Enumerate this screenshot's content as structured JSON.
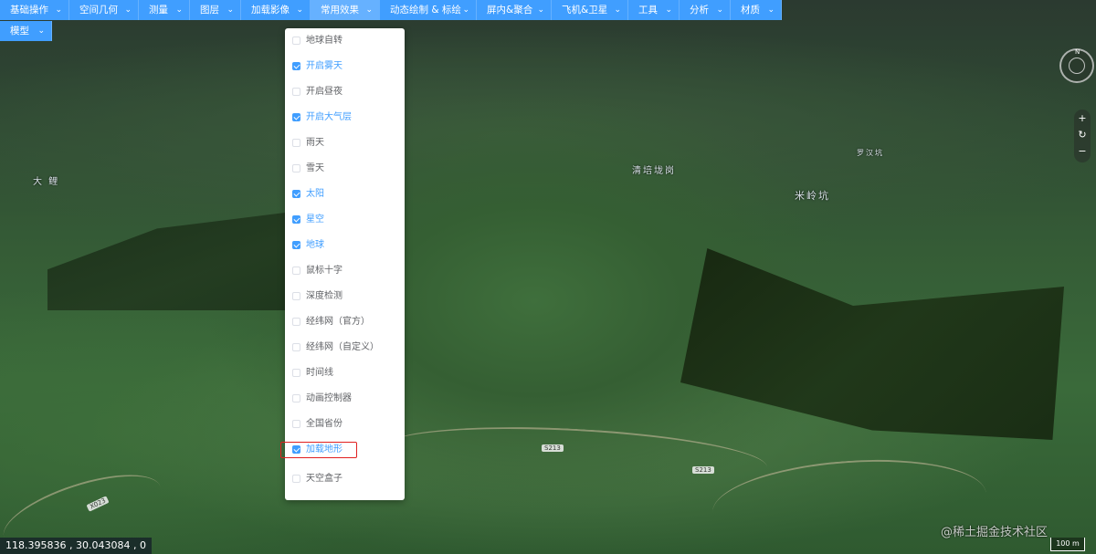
{
  "menu": {
    "items": [
      {
        "label": "基础操作"
      },
      {
        "label": "空间几何"
      },
      {
        "label": "测量"
      },
      {
        "label": "图层"
      },
      {
        "label": "加载影像"
      },
      {
        "label": "常用效果"
      },
      {
        "label": "动态绘制 & 标绘"
      },
      {
        "label": "屏内&聚合"
      },
      {
        "label": "飞机&卫星"
      },
      {
        "label": "工具"
      },
      {
        "label": "分析"
      },
      {
        "label": "材质"
      }
    ],
    "second_row": [
      {
        "label": "模型"
      }
    ],
    "active": "常用效果"
  },
  "dropdown": {
    "items": [
      {
        "label": "地球自转",
        "checked": false
      },
      {
        "label": "开启雾天",
        "checked": true
      },
      {
        "label": "开启昼夜",
        "checked": false
      },
      {
        "label": "开启大气层",
        "checked": true
      },
      {
        "label": "雨天",
        "checked": false
      },
      {
        "label": "雪天",
        "checked": false
      },
      {
        "label": "太阳",
        "checked": true
      },
      {
        "label": "星空",
        "checked": true
      },
      {
        "label": "地球",
        "checked": true
      },
      {
        "label": "鼠标十字",
        "checked": false
      },
      {
        "label": "深度检测",
        "checked": false
      },
      {
        "label": "经纬网（官方）",
        "checked": false
      },
      {
        "label": "经纬网（自定义）",
        "checked": false
      },
      {
        "label": "时间线",
        "checked": false
      },
      {
        "label": "动画控制器",
        "checked": false
      },
      {
        "label": "全国省份",
        "checked": false
      },
      {
        "label": "加载地形",
        "checked": true
      },
      {
        "label": "天空盒子",
        "checked": false
      }
    ],
    "highlighted": "加载地形"
  },
  "map": {
    "labels": [
      "清培垅岗",
      "米岭坑",
      "罗汉坑",
      "大 鲤"
    ],
    "road_tags": [
      "S213",
      "S213",
      "X023"
    ]
  },
  "nav": {
    "compass_letter": "N",
    "zoom_in": "+",
    "reset": "↻",
    "zoom_out": "−"
  },
  "status": {
    "coordinates": "118.395836 ,  30.043084 ,  0",
    "scale": "100 m",
    "watermark": "@稀土掘金技术社区"
  },
  "colors": {
    "accent": "#409eff",
    "highlight_border": "#e02020"
  }
}
